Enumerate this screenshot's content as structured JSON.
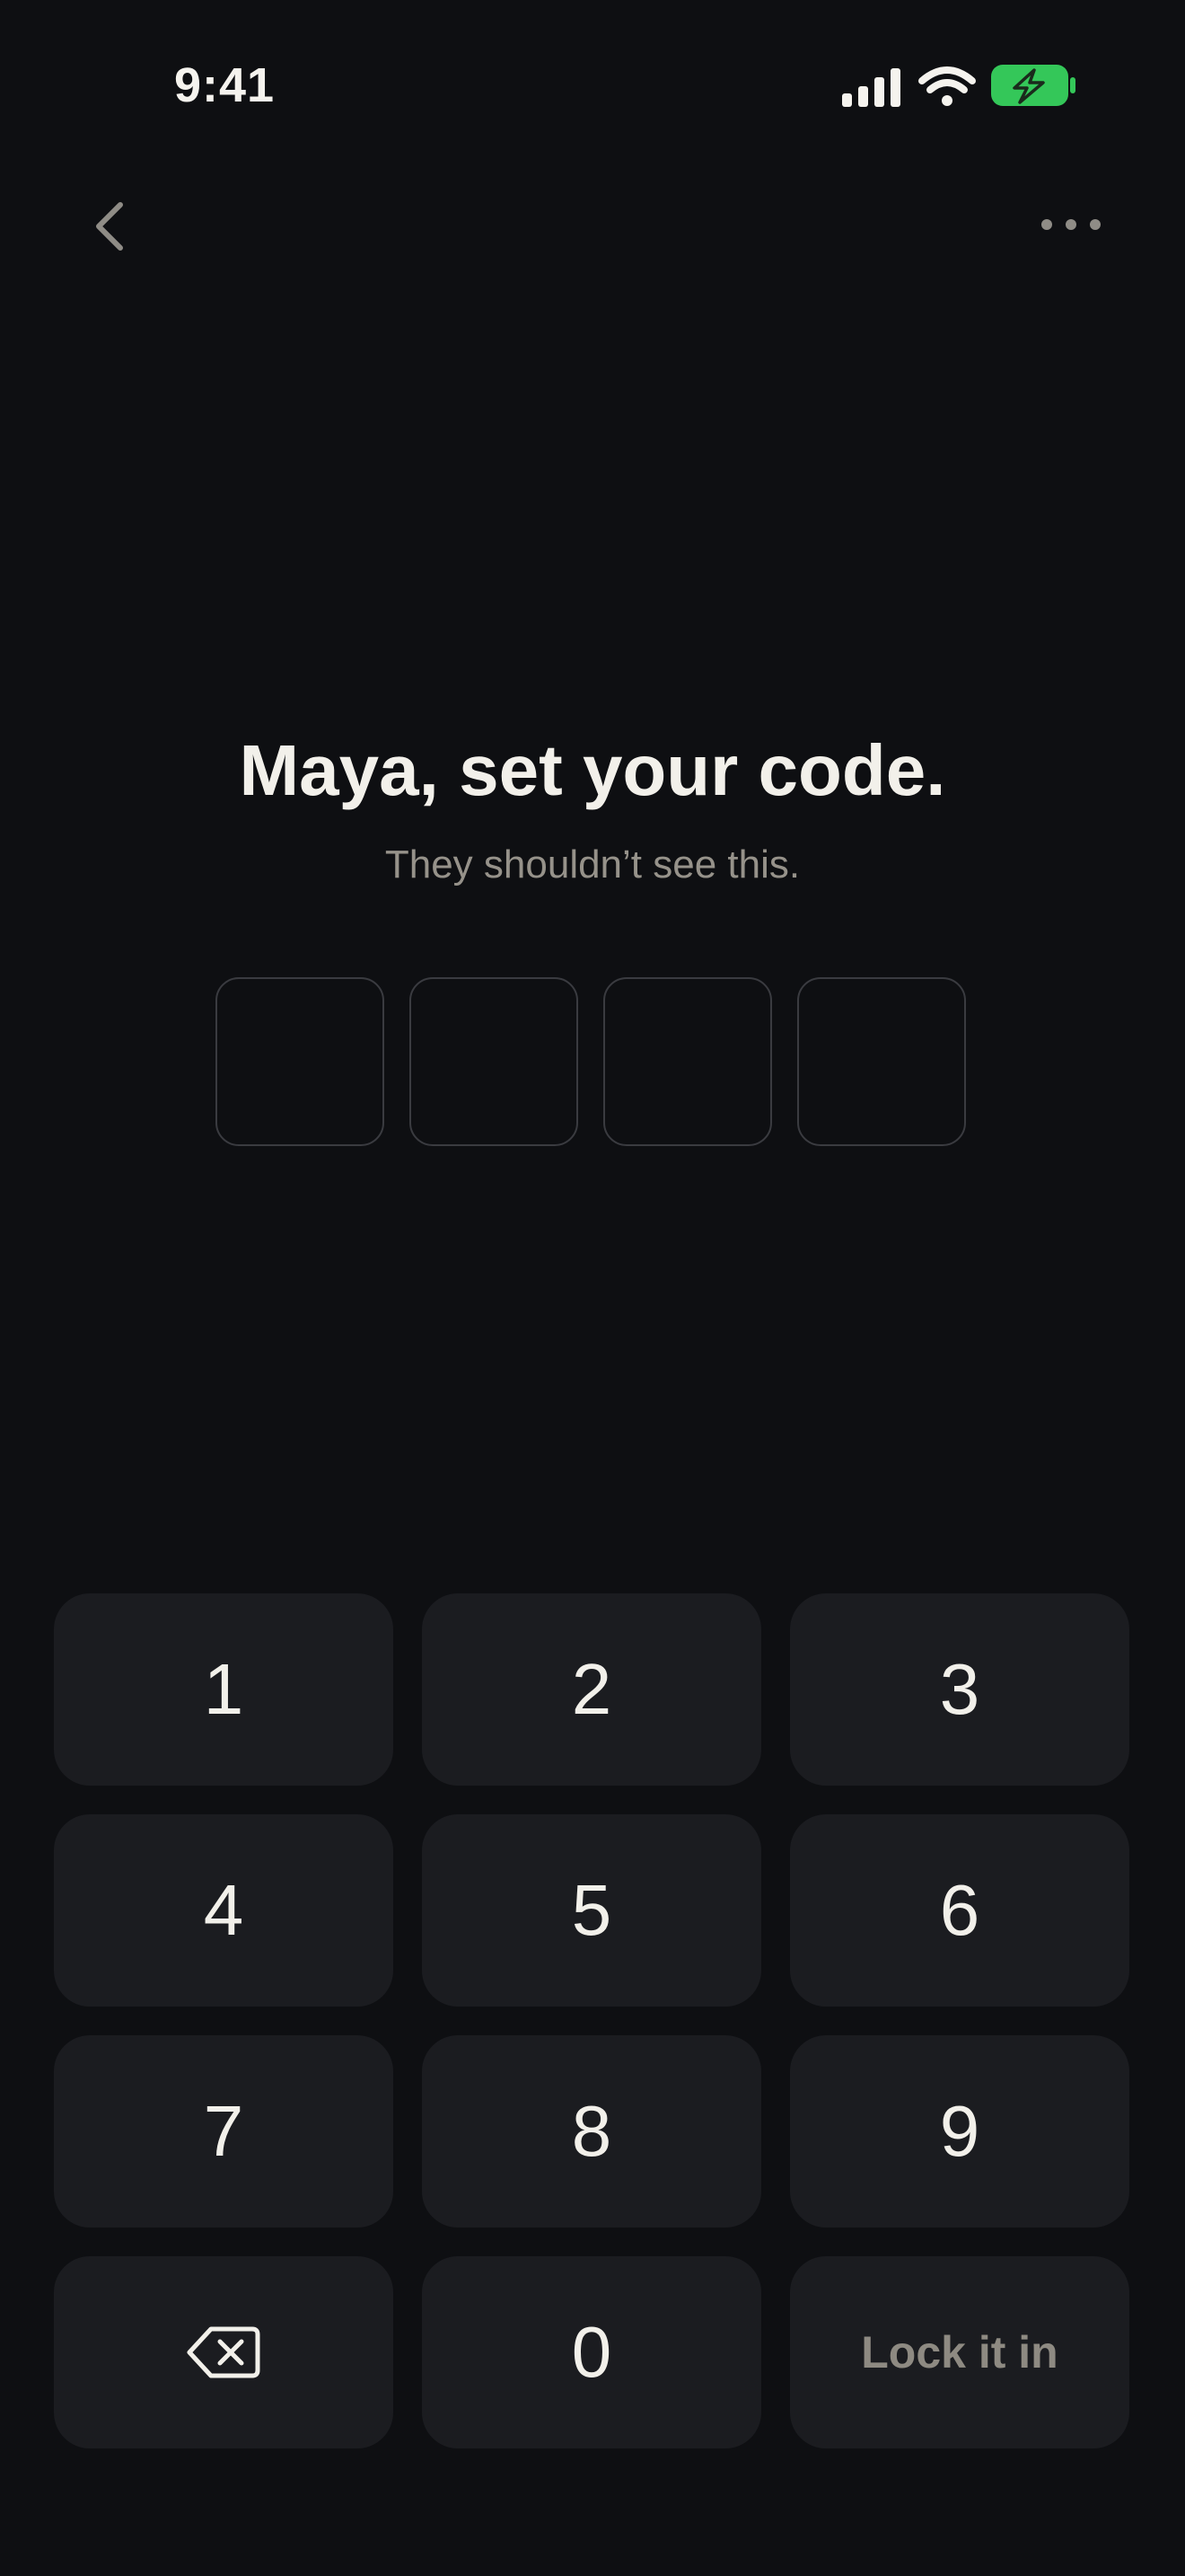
{
  "status_bar": {
    "time": "9:41",
    "icons": [
      "signal-icon",
      "wifi-icon",
      "battery-charging-icon"
    ],
    "battery_color": "#34c759"
  },
  "nav": {
    "back_icon": "chevron-left-icon",
    "more_icon": "ellipsis-icon"
  },
  "header": {
    "title": "Maya, set your code.",
    "subtitle": "They shouldn’t see this."
  },
  "code": {
    "length": 4,
    "entered": 0
  },
  "keypad": {
    "keys": [
      {
        "label": "1"
      },
      {
        "label": "2"
      },
      {
        "label": "3"
      },
      {
        "label": "4"
      },
      {
        "label": "5"
      },
      {
        "label": "6"
      },
      {
        "label": "7"
      },
      {
        "label": "8"
      },
      {
        "label": "9"
      },
      {
        "icon": "backspace-icon"
      },
      {
        "label": "0"
      },
      {
        "label": "Lock it in"
      }
    ]
  },
  "colors": {
    "background": "#0e0f12",
    "key_background": "#1b1c20",
    "text_primary": "#f2f0ea",
    "text_secondary": "#96928a",
    "box_border": "#3a3b40"
  }
}
